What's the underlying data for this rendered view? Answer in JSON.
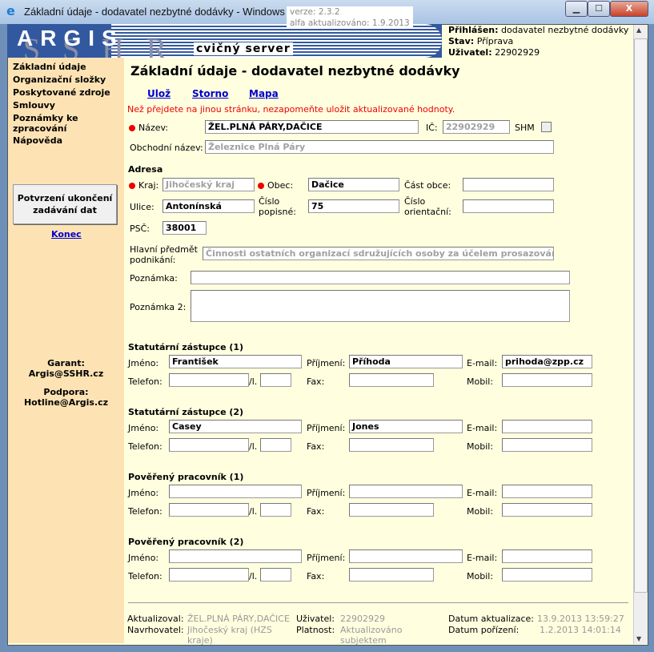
{
  "window": {
    "title": "Základní údaje - dodavatel nezbytné dodávky - Windows Internet Explorer",
    "minimize": "▁",
    "maximize": "☐",
    "close": "X"
  },
  "header": {
    "logo": "ARGIS",
    "logo_bg": "SSHR",
    "version": "verze: 2.3.2",
    "updated": "alfa aktualizováno: 1.9.2013",
    "server": "cvičný server",
    "logged_label": "Přihlášen:",
    "logged_value": "dodavatel nezbytné dodávky",
    "state_label": "Stav:",
    "state_value": "Příprava",
    "user_label": "Uživatel:",
    "user_value": "22902929"
  },
  "sidebar": {
    "items": [
      "Základní údaje",
      "Organizační složky",
      "Poskytované zdroje",
      "Smlouvy",
      "Poznámky ke zpracování",
      "Nápověda"
    ],
    "confirm_button": "Potvrzení ukončení zadávání dat",
    "logout": "Konec",
    "garant_label": "Garant:",
    "garant_value": "Argis@SSHR.cz",
    "support_label": "Podpora:",
    "support_value": "Hotline@Argis.cz"
  },
  "main": {
    "title": "Základní údaje - dodavatel nezbytné dodávky",
    "actions": {
      "save": "Ulož",
      "cancel": "Storno",
      "map": "Mapa"
    },
    "warning": "Než přejdete na jinou stránku, nezapomeňte uložit aktualizované hodnoty.",
    "fields": {
      "nazev_label": "Název:",
      "nazev": "ŽEL.PLNÁ PÁRY,DAČICE",
      "ic_label": "IČ:",
      "ic": "22902929",
      "shm_label": "SHM",
      "shm_checked": false,
      "obchodni_label": "Obchodní název:",
      "obchodni": "Železnice Plná Páry",
      "adresa": "Adresa",
      "kraj_label": "Kraj:",
      "kraj": "Jihočeský kraj",
      "obec_label": "Obec:",
      "obec": "Dačice",
      "cast_label": "Část obce:",
      "cast": "",
      "ulice_label": "Ulice:",
      "ulice": "Antonínská",
      "cp_label": "Číslo popisné:",
      "cp": "75",
      "co_label": "Číslo orientační:",
      "co": "",
      "psc_label": "PSČ:",
      "psc": "38001",
      "predmet_label": "Hlavní předmět podnikání:",
      "predmet": "Činnosti ostatních organizací sdružujících osoby za účelem prosazování spole",
      "poznamka_label": "Poznámka:",
      "poznamka": "",
      "poznamka2_label": "Poznámka 2:",
      "poznamka2": ""
    },
    "contact_labels": {
      "jmeno": "Jméno:",
      "prijmeni": "Příjmení:",
      "email": "E-mail:",
      "telefon": "Telefon:",
      "ext": "/l.",
      "fax": "Fax:",
      "mobil": "Mobil:"
    },
    "contacts": [
      {
        "title": "Statutární zástupce (1)",
        "jmeno": "František",
        "prijmeni": "Příhoda",
        "email": "prihoda@zpp.cz",
        "telefon": "",
        "ext": "",
        "fax": "",
        "mobil": ""
      },
      {
        "title": "Statutární zástupce (2)",
        "jmeno": "Casey",
        "prijmeni": "Jones",
        "email": "",
        "telefon": "",
        "ext": "",
        "fax": "",
        "mobil": ""
      },
      {
        "title": "Pověřený pracovník (1)",
        "jmeno": "",
        "prijmeni": "",
        "email": "",
        "telefon": "",
        "ext": "",
        "fax": "",
        "mobil": ""
      },
      {
        "title": "Pověřený pracovník (2)",
        "jmeno": "",
        "prijmeni": "",
        "email": "",
        "telefon": "",
        "ext": "",
        "fax": "",
        "mobil": ""
      }
    ],
    "footer": {
      "aktualizoval_label": "Aktualizoval:",
      "aktualizoval": "ŽEL.PLNÁ PÁRY,DAČICE",
      "uzivatel_label": "Uživatel:",
      "uzivatel": "22902929",
      "datum_akt_label": "Datum aktualizace:",
      "datum_akt": "13.9.2013 13:59:27",
      "navrhovatel_label": "Navrhovatel:",
      "navrhovatel": "Jihočeský kraj (HZS kraje)",
      "platnost_label": "Platnost:",
      "platnost": "Aktualizováno subjektem",
      "datum_por_label": "Datum pořízení:",
      "datum_por": "1.2.2013 14:01:14"
    }
  },
  "colors": {
    "banner": "#32599f",
    "sidebar": "#fde3b4",
    "content": "#ffffe0",
    "link": "#0000cc",
    "warning": "#e00000",
    "required": "#e00000"
  }
}
